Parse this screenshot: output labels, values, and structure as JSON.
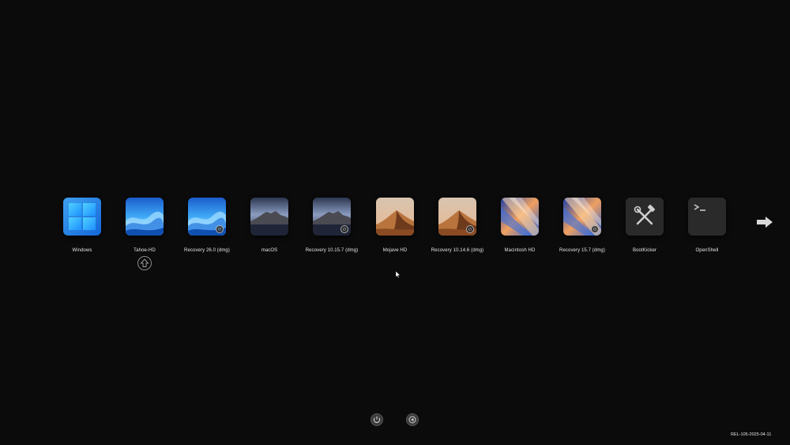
{
  "boot_entries": [
    {
      "label": "Windows",
      "icon": "windows-logo-icon"
    },
    {
      "label": "Tahoe-HD",
      "icon": "macos-tahoe-wallpaper-icon"
    },
    {
      "label": "Recovery 26.0 (dmg)",
      "icon": "macos-tahoe-wallpaper-icon",
      "badge": "recovery-badge-icon"
    },
    {
      "label": "macOS",
      "icon": "macos-catalina-wallpaper-icon"
    },
    {
      "label": "Recovery 10.15.7 (dmg)",
      "icon": "macos-catalina-wallpaper-icon",
      "badge": "recovery-badge-icon"
    },
    {
      "label": "Mojave HD",
      "icon": "macos-mojave-wallpaper-icon"
    },
    {
      "label": "Recovery 10.14.6 (dmg)",
      "icon": "macos-mojave-wallpaper-icon",
      "badge": "recovery-badge-icon"
    },
    {
      "label": "Macintosh HD",
      "icon": "macos-sequoia-wallpaper-icon"
    },
    {
      "label": "Recovery 15.7 (dmg)",
      "icon": "macos-sequoia-wallpaper-icon",
      "badge": "recovery-badge-icon"
    },
    {
      "label": "BootKicker",
      "icon": "tools-icon"
    },
    {
      "label": "OpenShell",
      "icon": "terminal-icon"
    }
  ],
  "selected_entry": "Tahoe-HD",
  "selection_indicator_icon": "up-arrow-circle-icon",
  "next_page_icon": "right-arrow-icon",
  "controls": {
    "shutdown_icon": "power-icon",
    "restart_icon": "restart-icon"
  },
  "version_text": "REL-105-2025-04-11",
  "colors": {
    "background": "#0b0b0b",
    "text": "#e6e6e6"
  }
}
